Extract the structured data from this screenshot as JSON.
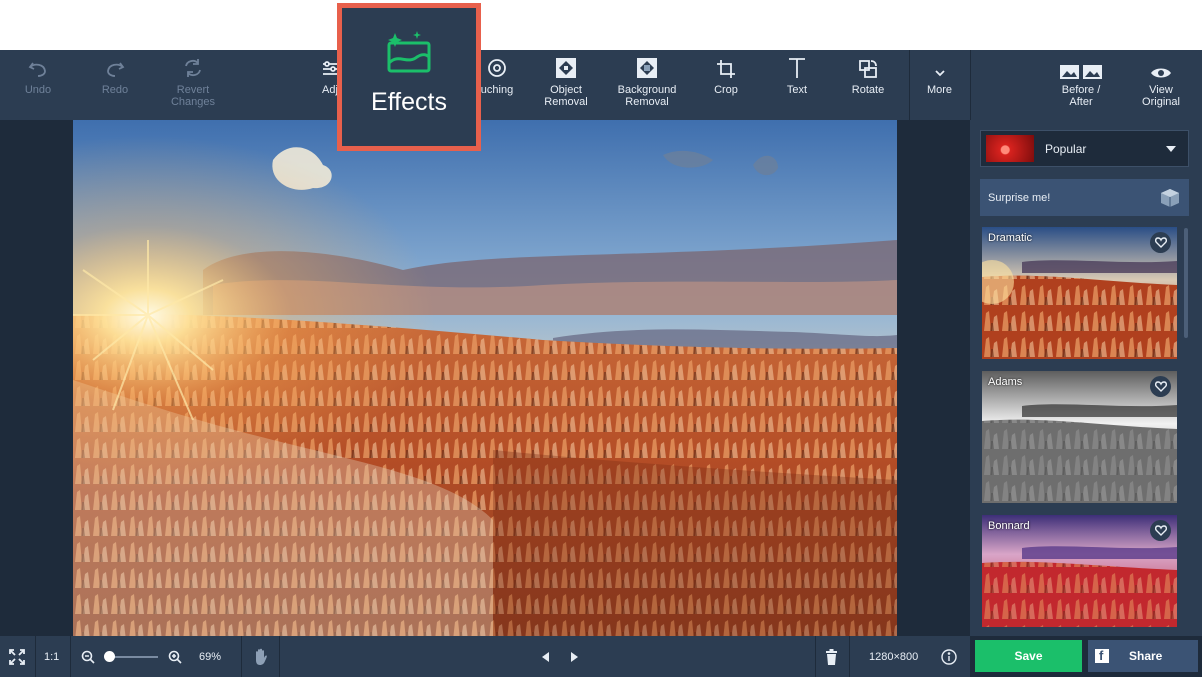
{
  "toolbar": {
    "undo": "Undo",
    "redo": "Redo",
    "revert": "Revert\nChanges",
    "adjust_partial": "Adj",
    "retouching_partial": "uching",
    "object_removal": "Object\nRemoval",
    "background_removal": "Background\nRemoval",
    "crop": "Crop",
    "text": "Text",
    "rotate": "Rotate",
    "more": "More",
    "before_after": "Before /\nAfter",
    "view_original": "View\nOriginal"
  },
  "callout": {
    "label": "Effects",
    "icon": "effects-icon",
    "color": "#e8604c"
  },
  "sidebar": {
    "preset": "Popular",
    "surprise": "Surprise me!",
    "effects": [
      {
        "name": "Dramatic"
      },
      {
        "name": "Adams"
      },
      {
        "name": "Bonnard"
      }
    ]
  },
  "bottom": {
    "actual_size": "1:1",
    "zoom": "69%",
    "dimensions": "1280×800"
  },
  "actions": {
    "save": "Save",
    "share": "Share"
  },
  "colors": {
    "accent_green": "#1bbf6a",
    "toolbar_bg": "#2c3d52",
    "app_bg": "#1e2b3b"
  }
}
